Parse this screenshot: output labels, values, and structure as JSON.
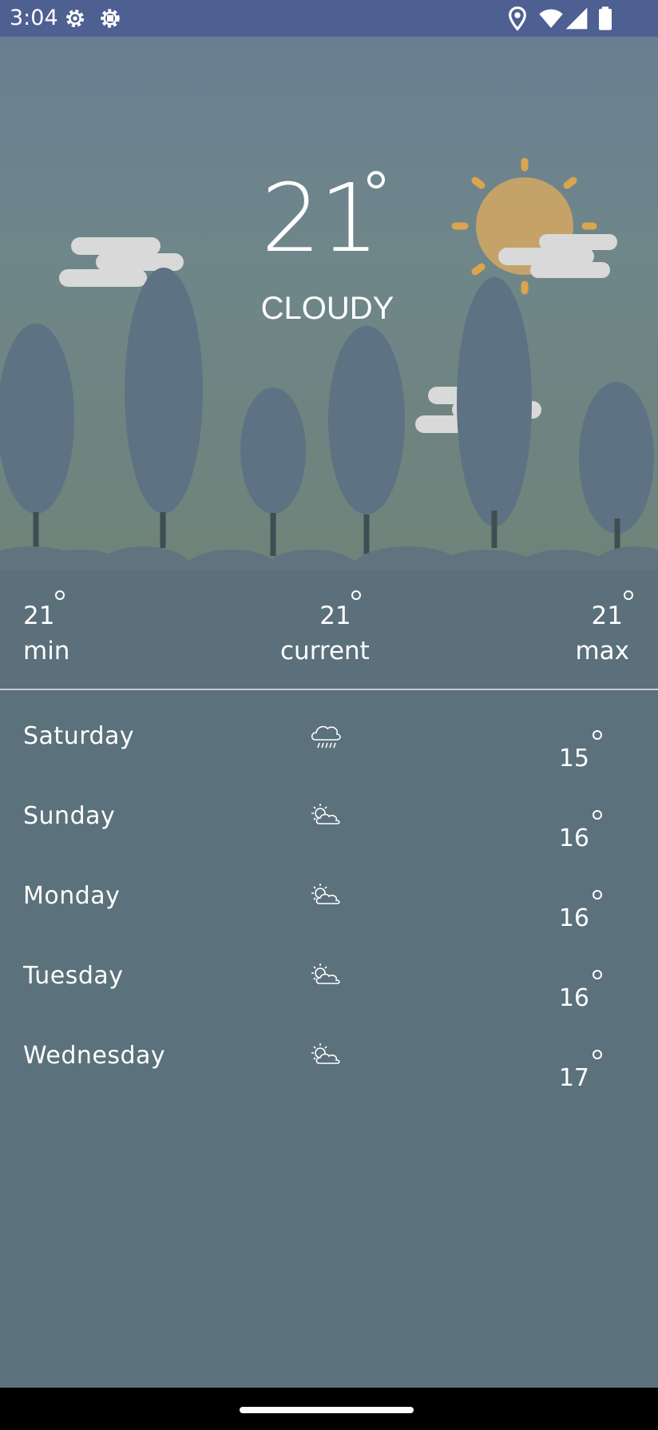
{
  "status_bar": {
    "time": "3:04",
    "icons": [
      "gear-icon",
      "gear-icon",
      "location-pin-icon",
      "wifi-icon",
      "signal-icon",
      "battery-icon"
    ]
  },
  "current": {
    "temperature": "21",
    "condition": "CLOUDY"
  },
  "summary": {
    "min": {
      "value": "21",
      "label": "min"
    },
    "current": {
      "value": "21",
      "label": "current"
    },
    "max": {
      "value": "21",
      "label": "max"
    }
  },
  "forecast": [
    {
      "day": "Saturday",
      "icon": "rain-cloud-icon",
      "temp": "15"
    },
    {
      "day": "Sunday",
      "icon": "partly-cloudy-icon",
      "temp": "16"
    },
    {
      "day": "Monday",
      "icon": "partly-cloudy-icon",
      "temp": "16"
    },
    {
      "day": "Tuesday",
      "icon": "partly-cloudy-icon",
      "temp": "16"
    },
    {
      "day": "Wednesday",
      "icon": "partly-cloudy-icon",
      "temp": "17"
    }
  ],
  "colors": {
    "status_bar": "#4e5f91",
    "panel": "#5b707a",
    "sun": "#c9a466",
    "sun_rays": "#dba44e",
    "cloud": "#d9d9d9",
    "tree": "#5d7282"
  }
}
